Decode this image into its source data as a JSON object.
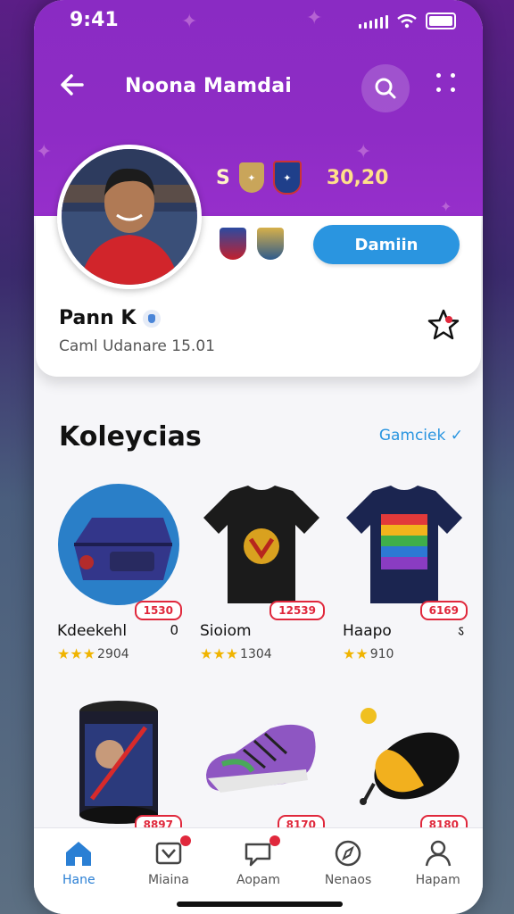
{
  "status": {
    "time": "9:41"
  },
  "header": {
    "title": "Noona Mamdai"
  },
  "profile": {
    "stats_label": "S",
    "stats_value": "30,20",
    "follow_label": "Damiin",
    "name": "Pann K",
    "subtitle": "Caml Udanare 15.01"
  },
  "collection": {
    "title": "Koleycias",
    "action": "Gamciek ✓",
    "items": [
      {
        "name": "Kdeekehl",
        "count": "0",
        "price": "1530",
        "rating": "2904",
        "stars": 3
      },
      {
        "name": "Sioiom",
        "count": "",
        "price": "12539",
        "rating": "1304",
        "stars": 3
      },
      {
        "name": "Haapo",
        "count": "ऽ",
        "price": "6169",
        "rating": "910",
        "stars": 2
      },
      {
        "name": "",
        "count": "",
        "price": "8897",
        "rating": "",
        "stars": 0
      },
      {
        "name": "",
        "count": "",
        "price": "8170",
        "rating": "",
        "stars": 0
      },
      {
        "name": "",
        "count": "",
        "price": "8180",
        "rating": "",
        "stars": 0
      }
    ]
  },
  "tabs": [
    {
      "label": "Hane",
      "icon": "home-icon",
      "active": true
    },
    {
      "label": "Miaina",
      "icon": "inbox-icon",
      "badge": true
    },
    {
      "label": "Aopam",
      "icon": "chat-icon",
      "badge": true
    },
    {
      "label": "Nenaos",
      "icon": "compass-icon"
    },
    {
      "label": "Hapam",
      "icon": "profile-icon"
    }
  ],
  "colors": {
    "purple": "#8a2bc3",
    "accent": "#2a95e0",
    "price": "#e0283c"
  }
}
